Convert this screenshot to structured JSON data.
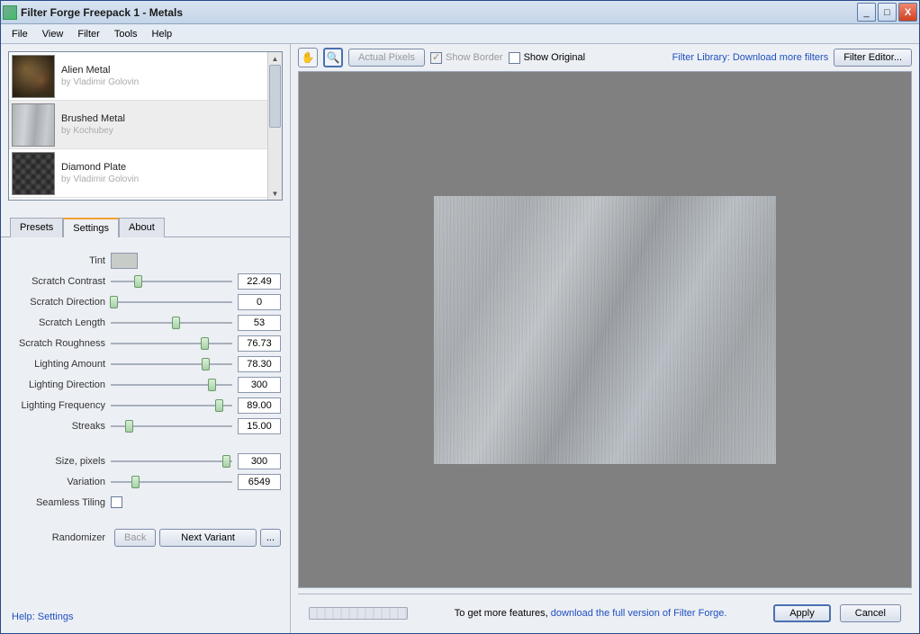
{
  "window": {
    "title": "Filter Forge Freepack 1 - Metals"
  },
  "menu": {
    "items": [
      "File",
      "View",
      "Filter",
      "Tools",
      "Help"
    ]
  },
  "filters": [
    {
      "name": "Alien Metal",
      "author": "by Vladimir Golovin",
      "selected": false,
      "thumb": "alien"
    },
    {
      "name": "Brushed Metal",
      "author": "by Kochubey",
      "selected": true,
      "thumb": "brushed"
    },
    {
      "name": "Diamond Plate",
      "author": "by Vladimir Golovin",
      "selected": false,
      "thumb": "diamond"
    }
  ],
  "tabs": {
    "items": [
      "Presets",
      "Settings",
      "About"
    ],
    "active": 1
  },
  "settings": {
    "tint_label": "Tint",
    "params": [
      {
        "label": "Scratch Contrast",
        "value": "22.49",
        "pos": 22
      },
      {
        "label": "Scratch Direction",
        "value": "0",
        "pos": 2
      },
      {
        "label": "Scratch Length",
        "value": "53",
        "pos": 53
      },
      {
        "label": "Scratch Roughness",
        "value": "76.73",
        "pos": 77
      },
      {
        "label": "Lighting Amount",
        "value": "78.30",
        "pos": 78
      },
      {
        "label": "Lighting Direction",
        "value": "300",
        "pos": 83
      },
      {
        "label": "Lighting Frequency",
        "value": "89.00",
        "pos": 89
      },
      {
        "label": "Streaks",
        "value": "15.00",
        "pos": 15
      }
    ],
    "extra": [
      {
        "label": "Size, pixels",
        "value": "300",
        "pos": 95
      },
      {
        "label": "Variation",
        "value": "6549",
        "pos": 20
      }
    ],
    "seamless_label": "Seamless Tiling",
    "randomizer": {
      "label": "Randomizer",
      "back": "Back",
      "next": "Next Variant",
      "dots": "..."
    }
  },
  "help": {
    "label": "Help: Settings"
  },
  "toolbar": {
    "actual_pixels": "Actual Pixels",
    "show_border": "Show Border",
    "show_original": "Show Original",
    "library_link": "Filter Library: Download more filters",
    "editor_btn": "Filter Editor..."
  },
  "footer": {
    "msg_prefix": "To get more features, ",
    "msg_link": "download the full version of Filter Forge.",
    "apply": "Apply",
    "cancel": "Cancel"
  }
}
